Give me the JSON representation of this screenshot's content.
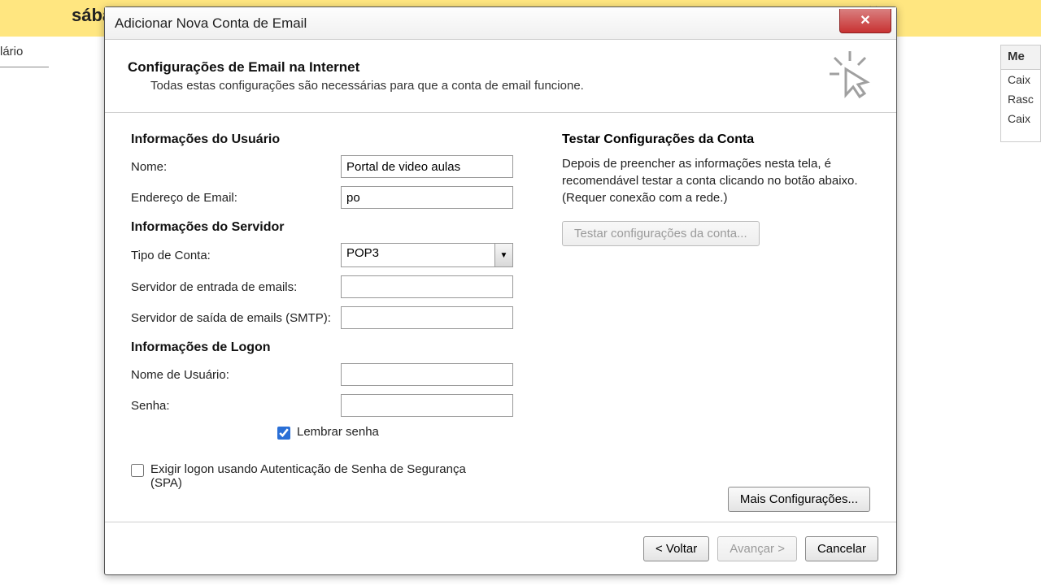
{
  "background": {
    "saba": "sába",
    "tab": "lário",
    "panel_header": "Me",
    "panel_items": [
      "Caix",
      "Rasc",
      "Caix"
    ]
  },
  "dialog": {
    "title": "Adicionar Nova Conta de Email",
    "header": {
      "title": "Configurações de Email na Internet",
      "subtitle": "Todas estas configurações são necessárias para que a conta de email funcione."
    },
    "user_info": {
      "section": "Informações do Usuário",
      "name_label": "Nome:",
      "name_value": "Portal de video aulas",
      "email_label": "Endereço de Email:",
      "email_value": "po"
    },
    "server_info": {
      "section": "Informações do Servidor",
      "type_label": "Tipo de Conta:",
      "type_value": "POP3",
      "incoming_label": "Servidor de entrada de emails:",
      "incoming_value": "",
      "outgoing_label": "Servidor de saída de emails (SMTP):",
      "outgoing_value": ""
    },
    "logon_info": {
      "section": "Informações de Logon",
      "user_label": "Nome de Usuário:",
      "user_value": "",
      "pass_label": "Senha:",
      "pass_value": "",
      "remember_label": "Lembrar senha",
      "spa_label": "Exigir logon usando Autenticação de Senha de Segurança (SPA)"
    },
    "test": {
      "section": "Testar Configurações da Conta",
      "body": "Depois de preencher as informações nesta tela, é recomendável testar a conta clicando no botão abaixo. (Requer conexão com a rede.)",
      "button": "Testar configurações da conta...",
      "more_settings": "Mais Configurações..."
    },
    "footer": {
      "back": "< Voltar",
      "next": "Avançar >",
      "cancel": "Cancelar"
    }
  }
}
